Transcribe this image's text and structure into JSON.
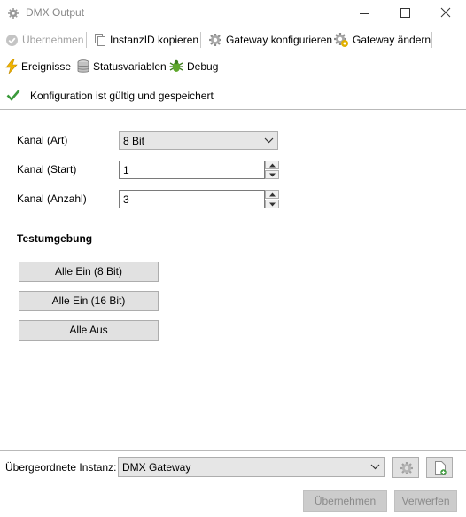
{
  "window": {
    "title": "DMX Output"
  },
  "toolbar1": {
    "apply_label": "Übernehmen",
    "copy_id_label": "InstanzID kopieren",
    "configure_gateway_label": "Gateway konfigurieren",
    "change_gateway_label": "Gateway ändern"
  },
  "toolbar2": {
    "events_label": "Ereignisse",
    "status_vars_label": "Statusvariablen",
    "debug_label": "Debug"
  },
  "status": {
    "message": "Konfiguration ist gültig und gespeichert"
  },
  "form": {
    "channel_type_label": "Kanal (Art)",
    "channel_type_value": "8 Bit",
    "channel_start_label": "Kanal (Start)",
    "channel_start_value": "1",
    "channel_count_label": "Kanal (Anzahl)",
    "channel_count_value": "3"
  },
  "test": {
    "title": "Testumgebung",
    "btn_all_on_8": "Alle Ein (8 Bit)",
    "btn_all_on_16": "Alle Ein (16 Bit)",
    "btn_all_off": "Alle Aus"
  },
  "parent": {
    "label": "Übergeordnete Instanz:",
    "value": "DMX Gateway"
  },
  "footer": {
    "apply_label": "Übernehmen",
    "discard_label": "Verwerfen"
  },
  "colors": {
    "ok_green": "#3a9a3a",
    "disabled_text": "#a0a0a0"
  }
}
